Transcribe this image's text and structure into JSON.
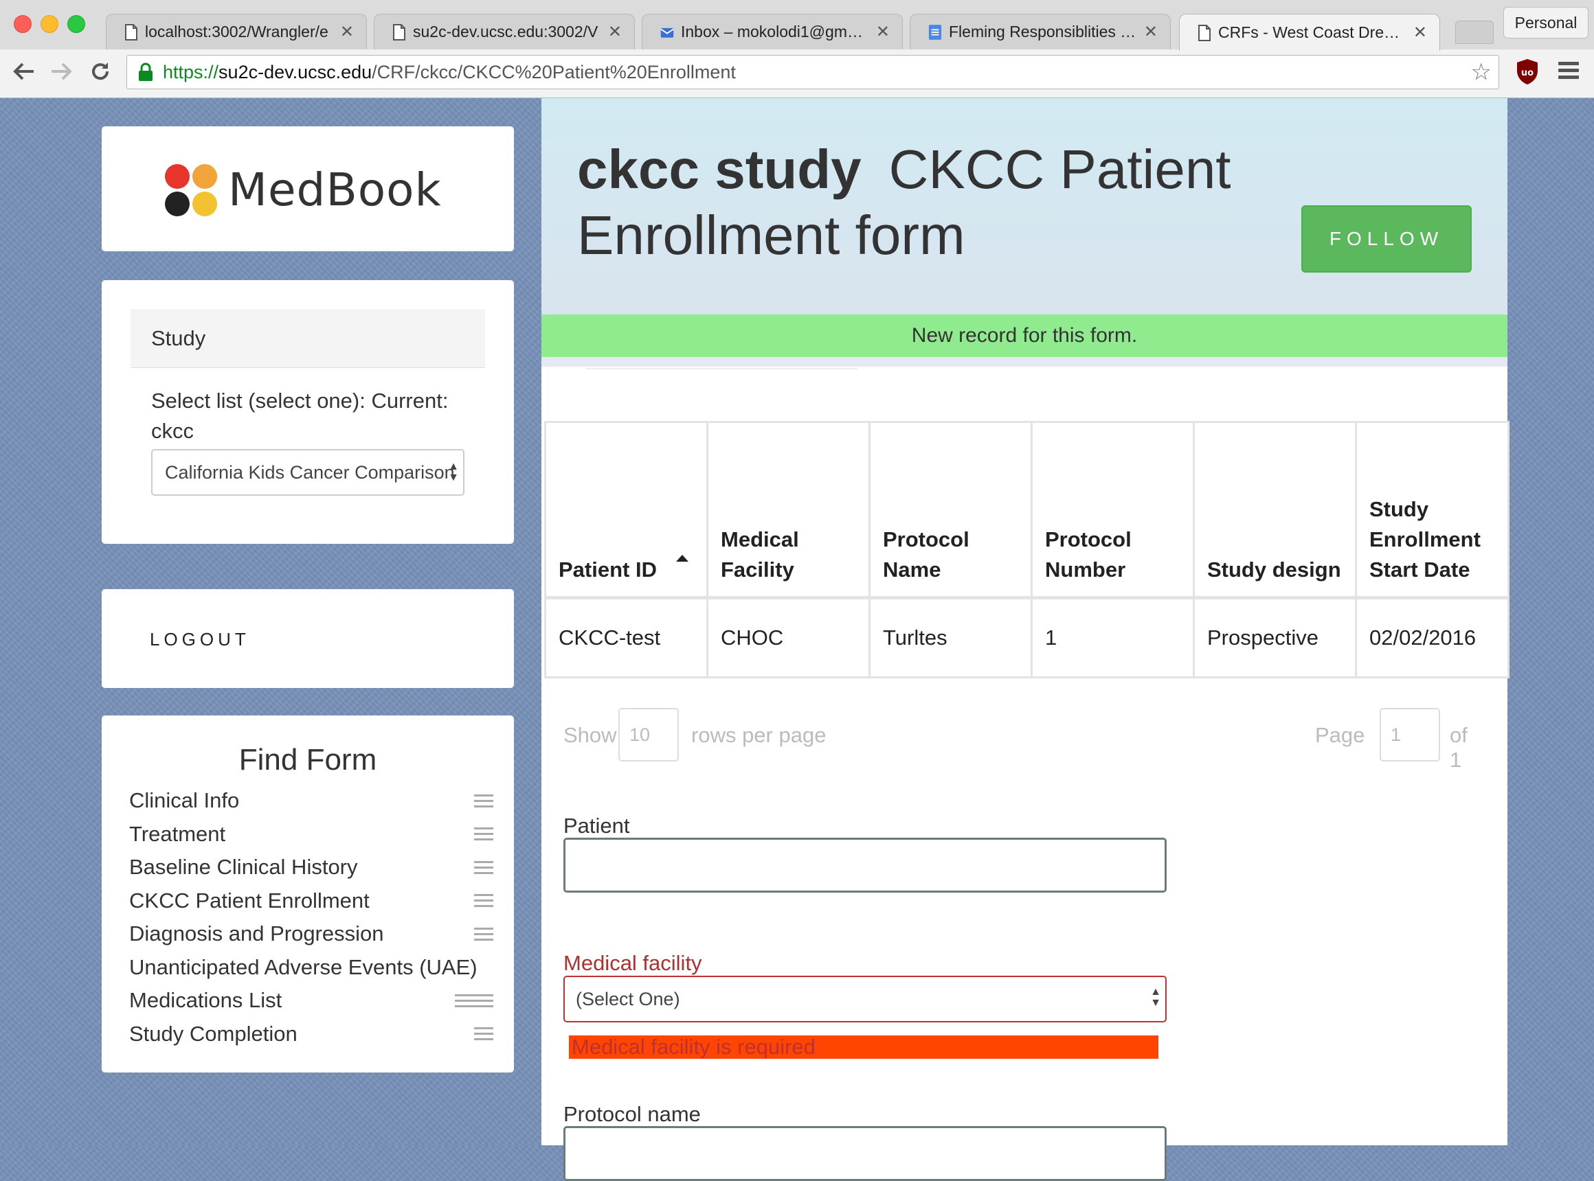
{
  "browser": {
    "tabs": [
      {
        "title": "localhost:3002/Wrangler/e",
        "icon": "document-icon"
      },
      {
        "title": "su2c-dev.ucsc.edu:3002/V",
        "icon": "document-icon"
      },
      {
        "title": "Inbox – mokolodi1@gmail.c",
        "icon": "inbox-icon"
      },
      {
        "title": "Fleming Responsiblities - G",
        "icon": "docs-icon"
      },
      {
        "title": "CRFs - West Coast Dream T",
        "icon": "document-icon",
        "active": true
      }
    ],
    "profile": "Personal",
    "url": {
      "scheme": "https://",
      "host": "su2c-dev.ucsc.edu",
      "path": "/CRF/ckcc/CKCC%20Patient%20Enrollment"
    }
  },
  "sidebar": {
    "logo_text": "MedBook",
    "logo_colors": [
      "#e8352c",
      "#f2a33a",
      "#222222",
      "#f2c230"
    ],
    "study": {
      "heading": "Study",
      "label": "Select list (select one): Current: ckcc",
      "selected": "California Kids Cancer Comparison"
    },
    "logout": "LOGOUT",
    "find_form": {
      "title": "Find Form",
      "items": [
        "Clinical Info",
        "Treatment",
        "Baseline Clinical History",
        "CKCC Patient Enrollment",
        "Diagnosis and Progression",
        "Unanticipated Adverse Events (UAE)",
        "Medications List",
        "Study Completion"
      ]
    }
  },
  "main": {
    "title_bold": "ckcc study",
    "title_rest": "CKCC Patient Enrollment form",
    "follow_label": "FOLLOW",
    "notice": "New record for this form.",
    "table": {
      "columns": [
        "Patient ID",
        "Medical Facility",
        "Protocol Name",
        "Protocol Number",
        "Study design",
        "Study Enrollment Start Date"
      ],
      "rows": [
        [
          "CKCC-test",
          "CHOC",
          "Turltes",
          "1",
          "Prospective",
          "02/02/2016"
        ]
      ]
    },
    "pager": {
      "show": "Show",
      "rows_value": "10",
      "rows_per_page": "rows per page",
      "page": "Page",
      "page_value": "1",
      "of": "of 1"
    },
    "form": {
      "patient_label": "Patient",
      "patient_value": "",
      "medical_facility_label": "Medical facility",
      "medical_facility_selected": "(Select One)",
      "medical_facility_error": "Medical facility is required",
      "protocol_name_label": "Protocol name"
    }
  },
  "colors": {
    "follow": "#5cb85c",
    "notice": "#90ea8e",
    "error_bar": "#ff4500",
    "error_text": "#c03030",
    "page_bg": "#7890b8"
  }
}
